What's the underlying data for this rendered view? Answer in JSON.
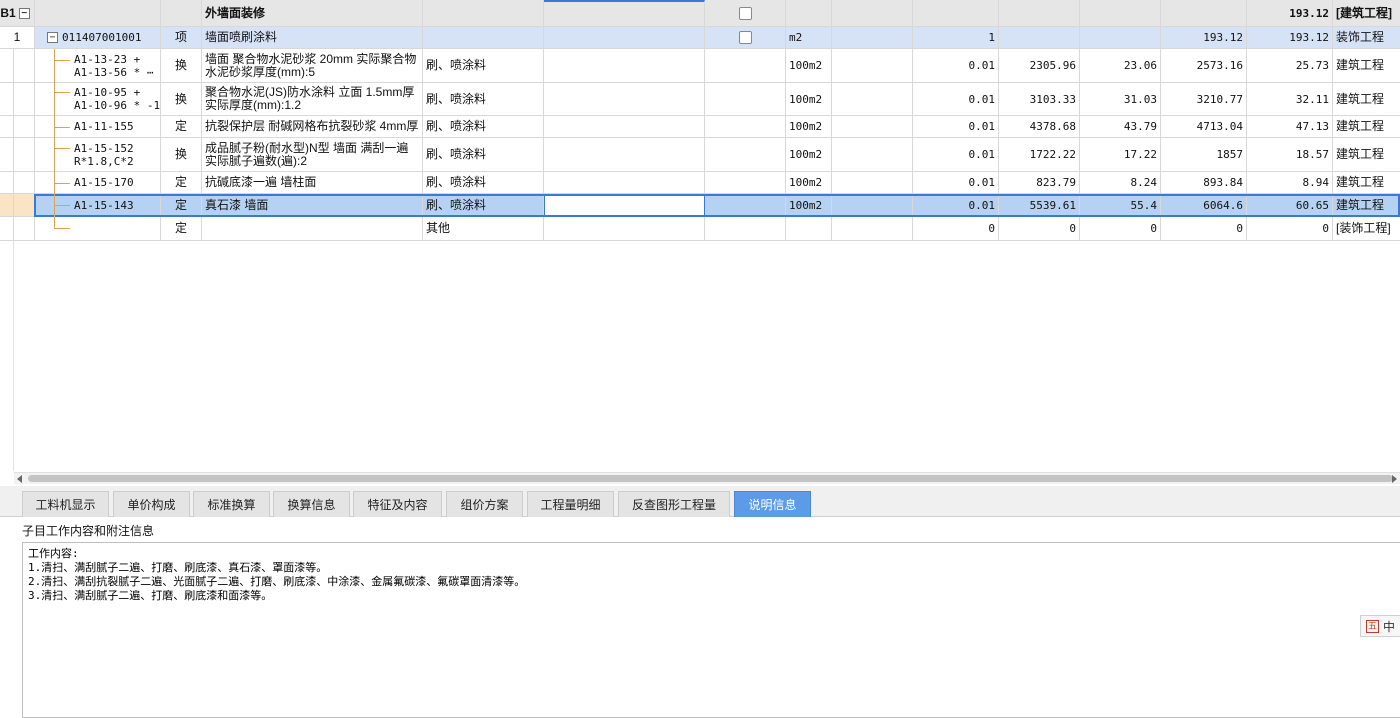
{
  "group": {
    "code": "B1",
    "expander": "−",
    "name": "外墙面装修",
    "total": "193.12",
    "category": "[建筑工程]"
  },
  "bill": {
    "index": "1",
    "expander": "−",
    "code": "011407001001",
    "type": "项",
    "name": "墙面喷刷涂料",
    "unit": "m2",
    "quantity": "1",
    "unit_price": "193.12",
    "total": "193.12",
    "category": "装饰工程"
  },
  "rows": [
    {
      "code": "A1-13-23 +\nA1-13-56 * ⋯",
      "type": "换",
      "name": "墙面 聚合物水泥砂浆 20mm  实际聚合物水泥砂浆厚度(mm):5",
      "feature": "刷、喷涂料",
      "unit": "100m2",
      "quantity": "0.01",
      "price": "2305.96",
      "amount": "23.06",
      "comp_price": "2573.16",
      "comp_amount": "25.73",
      "category": "建筑工程"
    },
    {
      "code": "A1-10-95 +\nA1-10-96 * -1",
      "type": "换",
      "name": "聚合物水泥(JS)防水涂料 立面 1.5mm厚  实际厚度(mm):1.2",
      "feature": "刷、喷涂料",
      "unit": "100m2",
      "quantity": "0.01",
      "price": "3103.33",
      "amount": "31.03",
      "comp_price": "3210.77",
      "comp_amount": "32.11",
      "category": "建筑工程"
    },
    {
      "code": "A1-11-155",
      "type": "定",
      "name": "抗裂保护层 耐碱网格布抗裂砂浆 4mm厚",
      "feature": "刷、喷涂料",
      "unit": "100m2",
      "quantity": "0.01",
      "price": "4378.68",
      "amount": "43.79",
      "comp_price": "4713.04",
      "comp_amount": "47.13",
      "category": "建筑工程"
    },
    {
      "code": "A1-15-152\nR*1.8,C*2",
      "type": "换",
      "name": "成品腻子粉(耐水型)N型 墙面 满刮一遍  实际腻子遍数(遍):2",
      "feature": "刷、喷涂料",
      "unit": "100m2",
      "quantity": "0.01",
      "price": "1722.22",
      "amount": "17.22",
      "comp_price": "1857",
      "comp_amount": "18.57",
      "category": "建筑工程"
    },
    {
      "code": "A1-15-170",
      "type": "定",
      "name": "抗碱底漆一遍 墙柱面",
      "feature": "刷、喷涂料",
      "unit": "100m2",
      "quantity": "0.01",
      "price": "823.79",
      "amount": "8.24",
      "comp_price": "893.84",
      "comp_amount": "8.94",
      "category": "建筑工程"
    },
    {
      "code": "A1-15-143",
      "type": "定",
      "name": "真石漆 墙面",
      "feature": "刷、喷涂料",
      "unit": "100m2",
      "quantity": "0.01",
      "price": "5539.61",
      "amount": "55.4",
      "comp_price": "6064.6",
      "comp_amount": "60.65",
      "category": "建筑工程"
    },
    {
      "code": "",
      "type": "定",
      "name": "",
      "feature": "其他",
      "unit": "",
      "quantity": "0",
      "price": "0",
      "amount": "0",
      "comp_price": "0",
      "comp_amount": "0",
      "category": "[装饰工程]"
    }
  ],
  "tabs": [
    {
      "label": "工料机显示",
      "active": false
    },
    {
      "label": "单价构成",
      "active": false
    },
    {
      "label": "标准换算",
      "active": false
    },
    {
      "label": "换算信息",
      "active": false
    },
    {
      "label": "特征及内容",
      "active": false
    },
    {
      "label": "组价方案",
      "active": false
    },
    {
      "label": "工程量明细",
      "active": false
    },
    {
      "label": "反查图形工程量",
      "active": false
    },
    {
      "label": "说明信息",
      "active": true
    }
  ],
  "panel": {
    "title": "子目工作内容和附注信息",
    "content": "工作内容:\n1.清扫、满刮腻子二遍、打磨、刷底漆、真石漆、罩面漆等。\n2.清扫、满刮抗裂腻子二遍、光面腻子二遍、打磨、刷底漆、中涂漆、金属氟碳漆、氟碳罩面清漆等。\n3.清扫、满刮腻子二遍、打磨、刷底漆和面漆等。"
  },
  "ime": {
    "icon": "五",
    "label": "中"
  },
  "colors": {
    "selection": "#b6d2f2",
    "bill_row": "#d6e3f7",
    "active_tab": "#5b9be8",
    "tree_line": "#d9a45a"
  }
}
